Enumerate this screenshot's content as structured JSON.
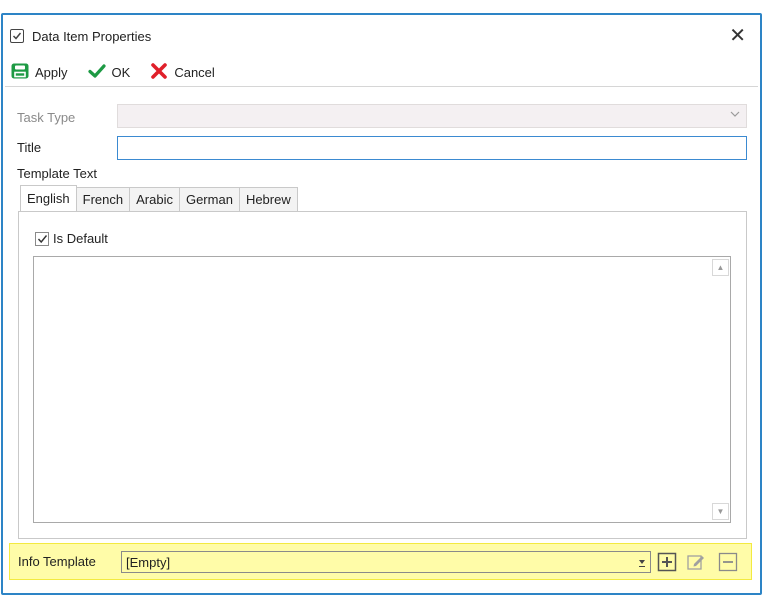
{
  "window": {
    "title": "Data Item Properties",
    "close_icon": "close-icon"
  },
  "toolbar": {
    "apply_label": "Apply",
    "ok_label": "OK",
    "cancel_label": "Cancel"
  },
  "form": {
    "task_type_label": "Task Type",
    "task_type_value": "",
    "title_label": "Title",
    "title_value": "",
    "template_text_label": "Template Text"
  },
  "tabs": [
    {
      "label": "English",
      "active": true
    },
    {
      "label": "French",
      "active": false
    },
    {
      "label": "Arabic",
      "active": false
    },
    {
      "label": "German",
      "active": false
    },
    {
      "label": "Hebrew",
      "active": false
    }
  ],
  "tab_panel": {
    "is_default_label": "Is Default",
    "is_default_checked": true,
    "text": ""
  },
  "info_template": {
    "label": "Info Template",
    "value": "[Empty]"
  },
  "colors": {
    "frame": "#2d84c6",
    "highlight": "#fffca8",
    "apply_green": "#1d9a44",
    "ok_green": "#1d9a44",
    "cancel_red": "#e0202a"
  }
}
